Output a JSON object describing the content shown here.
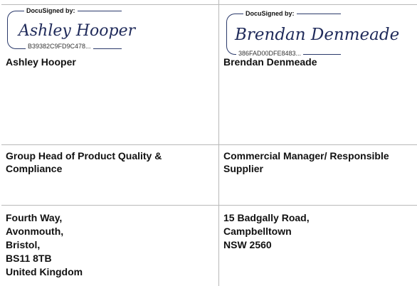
{
  "signatures": [
    {
      "header": "DocuSigned by:",
      "id": "B39382C9FD9C478...",
      "script_name": "Ashley Hooper",
      "stroke_color": "#1f2a5a"
    },
    {
      "header": "DocuSigned by:",
      "id": "386FAD00DFE8483...",
      "script_name": "Brendan Denmeade",
      "stroke_color": "#1f2a5a"
    }
  ],
  "rows": {
    "names": [
      "Ashley Hooper",
      "Brendan Denmeade"
    ],
    "titles": [
      [
        "Group Head of Product Quality &",
        "Compliance"
      ],
      [
        "Commercial Manager/ Responsible",
        "Supplier"
      ]
    ],
    "addresses": [
      [
        "Fourth Way,",
        "Avonmouth,",
        "Bristol,",
        "BS11 8TB",
        "United Kingdom"
      ],
      [
        "15 Badgally Road,",
        "Campbelltown",
        "NSW 2560"
      ]
    ]
  },
  "colors": {
    "grid_line": "#b9b9b9",
    "frame": "#2b3a6b"
  }
}
